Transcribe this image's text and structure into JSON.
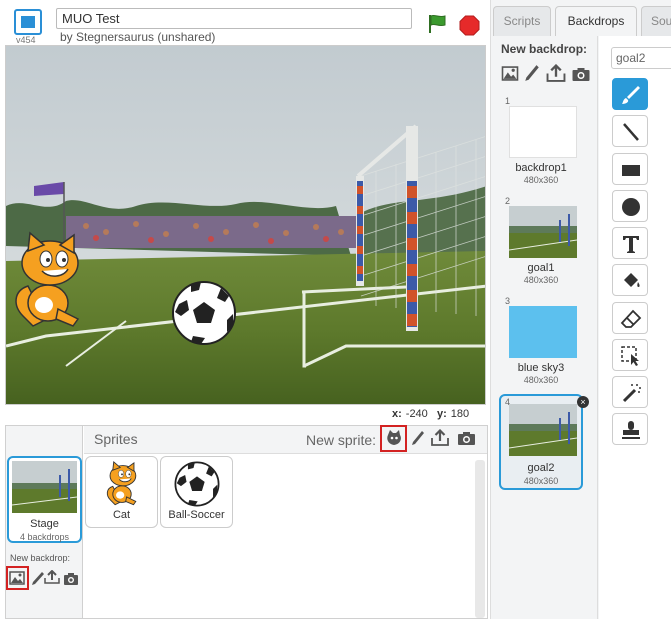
{
  "header": {
    "version": "v454",
    "project_title": "MUO Test",
    "author": "by Stegnersaurus (unshared)"
  },
  "stage": {
    "coords": {
      "x_label": "x:",
      "x_value": "-240",
      "y_label": "y:",
      "y_value": "180"
    }
  },
  "stage_panel": {
    "label": "Stage",
    "backdrop_count": "4 backdrops",
    "new_backdrop_label": "New backdrop:"
  },
  "sprites_panel": {
    "title": "Sprites",
    "new_sprite_label": "New sprite:",
    "sprites": [
      {
        "name": "Cat"
      },
      {
        "name": "Ball-Soccer"
      }
    ]
  },
  "tabs": [
    {
      "label": "Scripts"
    },
    {
      "label": "Backdrops"
    },
    {
      "label": "Sou"
    }
  ],
  "backdrops_panel": {
    "new_backdrop_label": "New backdrop:",
    "items": [
      {
        "num": "1",
        "name": "backdrop1",
        "size": "480x360"
      },
      {
        "num": "2",
        "name": "goal1",
        "size": "480x360"
      },
      {
        "num": "3",
        "name": "blue sky3",
        "size": "480x360"
      },
      {
        "num": "4",
        "name": "goal2",
        "size": "480x360"
      }
    ]
  },
  "paint_editor": {
    "costume_name": "goal2",
    "tools": [
      "brush-icon",
      "line-icon",
      "rectangle-icon",
      "ellipse-icon",
      "text-icon",
      "fill-icon",
      "eraser-icon",
      "select-icon",
      "magic-wand-icon",
      "stamp-icon"
    ]
  },
  "colors": {
    "accent_blue": "#2a9ad8",
    "flag_green": "#3b9a2e",
    "stop_red": "#e62a2a",
    "highlight_red": "#d32222",
    "sky_blue": "#5cc0ee"
  }
}
